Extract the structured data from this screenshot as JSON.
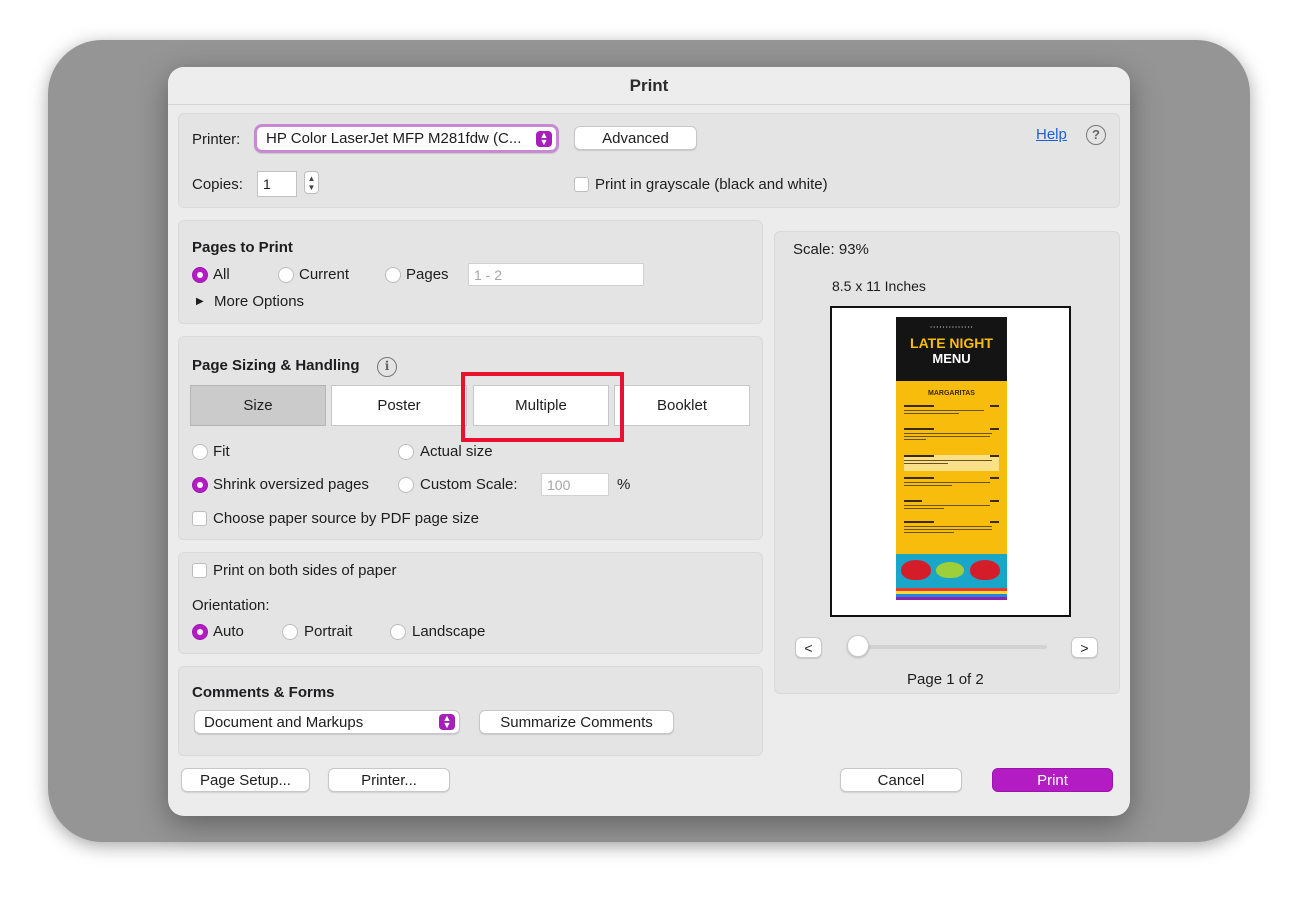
{
  "dialog": {
    "title": "Print"
  },
  "printer": {
    "label": "Printer:",
    "selected": "HP Color LaserJet MFP M281fdw (C...",
    "advanced": "Advanced",
    "help": "Help",
    "help_icon": "?"
  },
  "copies": {
    "label": "Copies:",
    "value": "1"
  },
  "grayscale": {
    "label": "Print in grayscale (black and white)"
  },
  "pages_to_print": {
    "title": "Pages to Print",
    "all": "All",
    "current": "Current",
    "pages": "Pages",
    "range_placeholder": "1 - 2",
    "more_options": "More Options"
  },
  "sizing": {
    "title": "Page Sizing & Handling",
    "info_icon": "i",
    "tabs": [
      "Size",
      "Poster",
      "Multiple",
      "Booklet"
    ],
    "fit": "Fit",
    "actual_size": "Actual size",
    "shrink": "Shrink oversized pages",
    "custom_scale": "Custom Scale:",
    "custom_scale_value": "100",
    "percent": "%",
    "paper_source": "Choose paper source by PDF page size"
  },
  "duplex": {
    "label": "Print on both sides of paper"
  },
  "orientation": {
    "label": "Orientation:",
    "auto": "Auto",
    "portrait": "Portrait",
    "landscape": "Landscape"
  },
  "comments": {
    "title": "Comments & Forms",
    "selected": "Document and Markups",
    "summarize": "Summarize Comments"
  },
  "preview": {
    "scale": "Scale:  93%",
    "paper_size": "8.5 x 11 Inches",
    "prev": "<",
    "next": ">",
    "page_indicator": "Page 1 of 2",
    "slider_position": 0,
    "document": {
      "kicker": "• • • • • • •  • • • • • • •",
      "title_line1": "LATE NIGHT",
      "title_line2": "MENU",
      "section": "MARGARITAS"
    }
  },
  "footer": {
    "page_setup": "Page Setup...",
    "printer": "Printer...",
    "cancel": "Cancel",
    "print": "Print"
  },
  "colors": {
    "accent": "#b21cc2",
    "highlight": "#e8122e",
    "link": "#1e5fd8"
  }
}
